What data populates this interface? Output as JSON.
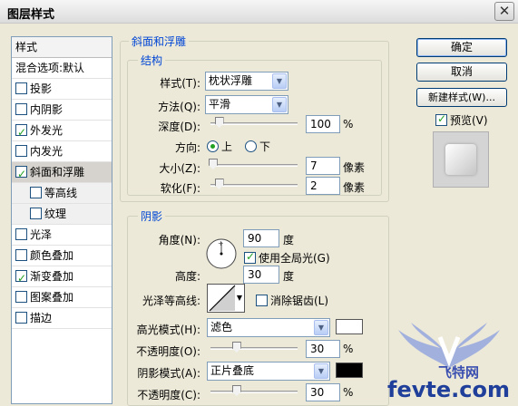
{
  "window": {
    "title": "图层样式",
    "close": "✕"
  },
  "style_list": {
    "header": "样式",
    "blend": "混合选项:默认",
    "items": [
      {
        "label": "投影",
        "checked": false
      },
      {
        "label": "内阴影",
        "checked": false
      },
      {
        "label": "外发光",
        "checked": true
      },
      {
        "label": "内发光",
        "checked": false
      },
      {
        "label": "斜面和浮雕",
        "checked": true
      },
      {
        "label": "等高线",
        "checked": false
      },
      {
        "label": "纹理",
        "checked": false
      },
      {
        "label": "光泽",
        "checked": false
      },
      {
        "label": "颜色叠加",
        "checked": false
      },
      {
        "label": "渐变叠加",
        "checked": true
      },
      {
        "label": "图案叠加",
        "checked": false
      },
      {
        "label": "描边",
        "checked": false
      }
    ]
  },
  "bevel": {
    "group_title": "斜面和浮雕",
    "structure_title": "结构",
    "style_label": "样式(T):",
    "style_value": "枕状浮雕",
    "technique_label": "方法(Q):",
    "technique_value": "平滑",
    "depth_label": "深度(D):",
    "depth_value": "100",
    "depth_unit": "%",
    "depth_fraction": 0.1,
    "direction_label": "方向:",
    "direction_up": "上",
    "direction_down": "下",
    "size_label": "大小(Z):",
    "size_value": "7",
    "size_unit": "像素",
    "size_fraction": 0.03,
    "soften_label": "软化(F):",
    "soften_value": "2",
    "soften_unit": "像素",
    "soften_fraction": 0.1
  },
  "shading": {
    "group_title": "阴影",
    "angle_label": "角度(N):",
    "angle_value": "90",
    "angle_unit": "度",
    "global_light": "使用全局光(G)",
    "altitude_label": "高度:",
    "altitude_value": "30",
    "altitude_unit": "度",
    "gloss_label": "光泽等高线:",
    "antialias": "消除锯齿(L)",
    "highlight_mode_label": "高光模式(H):",
    "highlight_mode_value": "滤色",
    "highlight_color": "#ffffff",
    "highlight_opacity_label": "不透明度(O):",
    "highlight_opacity_value": "30",
    "highlight_opacity_unit": "%",
    "highlight_opacity_fraction": 0.3,
    "shadow_mode_label": "阴影模式(A):",
    "shadow_mode_value": "正片叠底",
    "shadow_color": "#000000",
    "shadow_opacity_label": "不透明度(C):",
    "shadow_opacity_value": "30",
    "shadow_opacity_unit": "%",
    "shadow_opacity_fraction": 0.3
  },
  "buttons": {
    "ok": "确定",
    "cancel": "取消",
    "new_style": "新建样式(W)...",
    "preview": "预览(V)"
  },
  "watermark": {
    "brand": "飞特网",
    "site": "fevte.com"
  }
}
